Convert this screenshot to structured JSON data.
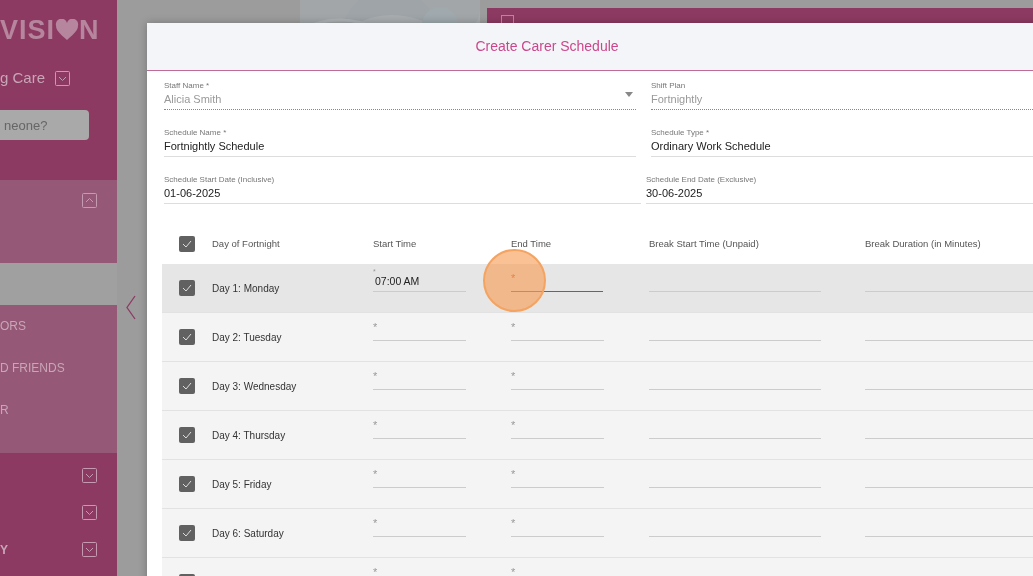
{
  "sidebar": {
    "logo_before": "VISI",
    "logo_after": "N",
    "org_name": "g Care",
    "search": {
      "placeholder": "neone?"
    },
    "sections": [
      {
        "expanded": true,
        "items": [
          {
            "selected": true
          },
          {
            "label": "ORS",
            "selected": false
          },
          {
            "label": "D FRIENDS",
            "selected": false
          },
          {
            "label": "R",
            "selected": false
          }
        ]
      },
      {
        "expanded": false
      },
      {
        "expanded": false
      },
      {
        "label": "Y",
        "expanded": false
      }
    ]
  },
  "modal": {
    "title": "Create Carer Schedule",
    "fields": [
      {
        "label": "Staff Name *",
        "value": "Alicia Smith",
        "kind": "select",
        "disabled": true
      },
      {
        "label": "Shift Plan",
        "value": "Fortnightly",
        "kind": "text",
        "disabled": true
      },
      {
        "label": "Schedule Name *",
        "value": "Fortnightly Schedule",
        "kind": "text",
        "disabled": false
      },
      {
        "label": "Schedule Type *",
        "value": "Ordinary Work Schedule",
        "kind": "text",
        "disabled": false
      },
      {
        "label": "Schedule Start Date (Inclusive)",
        "value": "01-06-2025",
        "kind": "text",
        "disabled": false
      },
      {
        "label": "Schedule End Date (Exclusive)",
        "value": "30-06-2025",
        "kind": "text",
        "disabled": false
      }
    ],
    "table": {
      "all_checked": true,
      "columns": [
        "Day of Fortnight",
        "Start Time",
        "End Time",
        "Break Start Time (Unpaid)",
        "Break Duration (in Minutes)"
      ],
      "rows": [
        {
          "checked": true,
          "hovered": true,
          "day": "Day 1: Monday",
          "start": {
            "label": "*",
            "value": "07:00 AM",
            "focused": false
          },
          "end": {
            "label": "*",
            "focused": true
          }
        },
        {
          "checked": true,
          "hovered": false,
          "day": "Day 2: Tuesday",
          "start": {
            "label": "*",
            "focused": false
          },
          "end": {
            "label": "*",
            "focused": false
          }
        },
        {
          "checked": true,
          "hovered": false,
          "day": "Day 3: Wednesday",
          "start": {
            "label": "*",
            "focused": false
          },
          "end": {
            "label": "*",
            "focused": false
          }
        },
        {
          "checked": true,
          "hovered": false,
          "day": "Day 4: Thursday",
          "start": {
            "label": "*",
            "focused": false
          },
          "end": {
            "label": "*",
            "focused": false
          }
        },
        {
          "checked": true,
          "hovered": false,
          "day": "Day 5: Friday",
          "start": {
            "label": "*",
            "focused": false
          },
          "end": {
            "label": "*",
            "focused": false
          }
        },
        {
          "checked": true,
          "hovered": false,
          "day": "Day 6: Saturday",
          "start": {
            "label": "*",
            "focused": false
          },
          "end": {
            "label": "*",
            "focused": false
          }
        },
        {
          "checked": true,
          "hovered": false,
          "start": {
            "label": "*",
            "focused": false
          },
          "end": {
            "label": "*",
            "focused": false
          }
        }
      ]
    }
  }
}
